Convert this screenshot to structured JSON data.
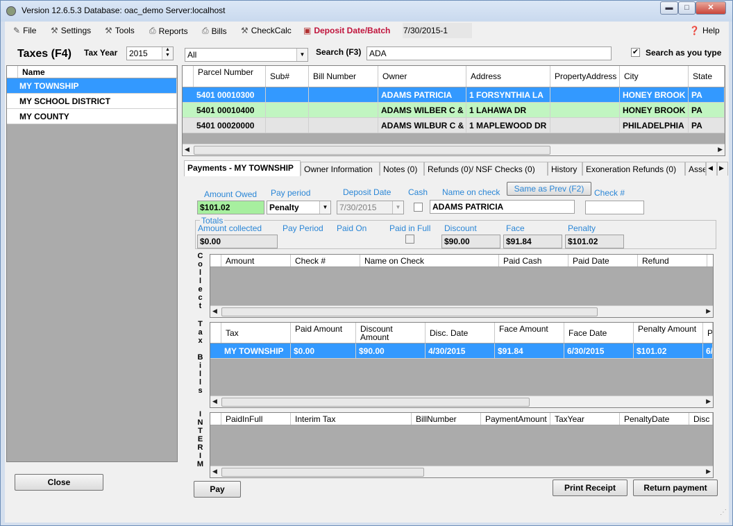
{
  "window": {
    "title": "Version 12.6.5.3 Database: oac_demo Server:localhost",
    "min_label": "▬",
    "max_label": "□",
    "close_label": "✕"
  },
  "menu": {
    "file": "File",
    "settings": "Settings",
    "tools": "Tools",
    "reports": "Reports",
    "bills": "Bills",
    "checkcalc": "CheckCalc",
    "deposit": "Deposit Date/Batch",
    "batch_value": "7/30/2015-1",
    "help": "Help"
  },
  "top": {
    "taxes_label": "Taxes (F4)",
    "tax_year_label": "Tax Year",
    "tax_year": "2015",
    "filter_value": "All",
    "search_label": "Search (F3)",
    "search_value": "ADA",
    "search_as_type_label": "Search as you type",
    "search_as_type_checked": true
  },
  "names": {
    "header": "Name",
    "items": [
      "MY TOWNSHIP",
      "MY SCHOOL DISTRICT",
      "MY COUNTY"
    ],
    "selected": 0
  },
  "parcels": {
    "headers": [
      "Parcel Number",
      "Sub#",
      "Bill Number",
      "Owner",
      "Address",
      "PropertyAddress",
      "City",
      "State"
    ],
    "rows": [
      [
        "5401 00010300",
        "",
        "",
        "ADAMS PATRICIA",
        "1 FORSYNTHIA LA",
        "",
        "HONEY BROOK",
        "PA"
      ],
      [
        "5401 00010400",
        "",
        "",
        "ADAMS WILBER C &",
        "1 LAHAWA DR",
        "",
        "HONEY BROOK",
        "PA"
      ],
      [
        "5401 00020000",
        "",
        "",
        "ADAMS WILBUR C &",
        "1 MAPLEWOOD DR",
        "",
        "PHILADELPHIA",
        "PA"
      ]
    ]
  },
  "tabs": [
    "Payments - MY TOWNSHIP",
    "Owner Information",
    "Notes (0)",
    "Refunds (0)/ NSF Checks (0)",
    "History",
    "Exoneration Refunds (0)",
    "Asse"
  ],
  "payment": {
    "amount_owed_label": "Amount Owed",
    "amount_owed": "$101.02",
    "pay_period_label": "Pay period",
    "pay_period": "Penalty",
    "deposit_date_label": "Deposit Date",
    "deposit_date": "7/30/2015",
    "cash_label": "Cash",
    "name_on_check_label": "Name on check",
    "name_on_check": "ADAMS PATRICIA",
    "same_as_prev": "Same as Prev (F2)",
    "check_label": "Check #",
    "check_value": ""
  },
  "totals": {
    "legend": "Totals",
    "amount_collected_label": "Amount collected",
    "amount_collected": "$0.00",
    "pay_period_label": "Pay Period",
    "paid_on_label": "Paid On",
    "paid_in_full_label": "Paid in Full",
    "discount_label": "Discount",
    "discount": "$90.00",
    "face_label": "Face",
    "face": "$91.84",
    "penalty_label": "Penalty",
    "penalty": "$101.02"
  },
  "collect": {
    "side_label": "Collect",
    "headers": [
      "Amount",
      "Check #",
      "Name on Check",
      "Paid Cash",
      "Paid Date",
      "Refund"
    ]
  },
  "taxbills": {
    "side_label": "Tax Bills",
    "headers": [
      "Tax",
      "Paid Amount",
      "Discount Amount",
      "Disc. Date",
      "Face Amount",
      "Face Date",
      "Penalty Amount",
      "P"
    ],
    "rows": [
      [
        "MY TOWNSHIP",
        "$0.00",
        "$90.00",
        "4/30/2015",
        "$91.84",
        "6/30/2015",
        "$101.02",
        "6/"
      ]
    ]
  },
  "interim": {
    "side_label": "INTERIM",
    "headers": [
      "PaidInFull",
      "Interim Tax",
      "BillNumber",
      "PaymentAmount",
      "TaxYear",
      "PenaltyDate",
      "Disc"
    ]
  },
  "buttons": {
    "close": "Close",
    "pay": "Pay",
    "print_receipt": "Print Receipt",
    "return_payment": "Return payment"
  }
}
